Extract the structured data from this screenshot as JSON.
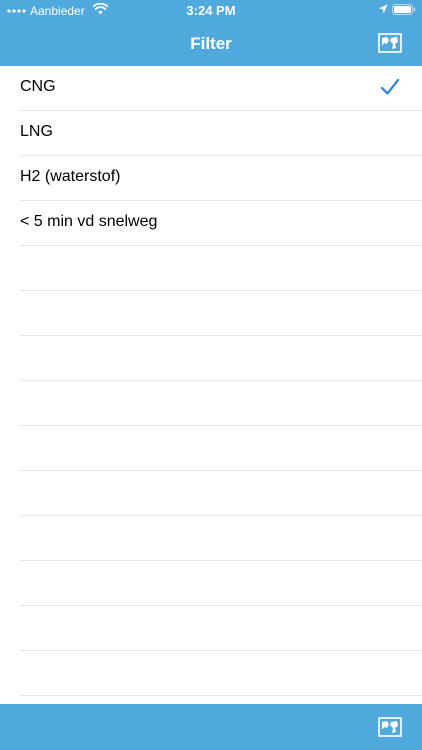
{
  "status_bar": {
    "carrier": "Aanbieder",
    "time": "3:24 PM"
  },
  "nav": {
    "title": "Filter"
  },
  "filters": [
    {
      "label": "CNG",
      "selected": true
    },
    {
      "label": "LNG",
      "selected": false
    },
    {
      "label": "H2 (waterstof)",
      "selected": false
    },
    {
      "label": "< 5 min vd snelweg",
      "selected": false
    }
  ],
  "empty_rows": 10,
  "colors": {
    "bar": "#4fa9dc",
    "check": "#2d7de0",
    "separator": "#e5e5e5"
  },
  "icons": {
    "nav_right": "map-icon",
    "footer_right": "map-icon",
    "selected": "checkmark-icon"
  }
}
